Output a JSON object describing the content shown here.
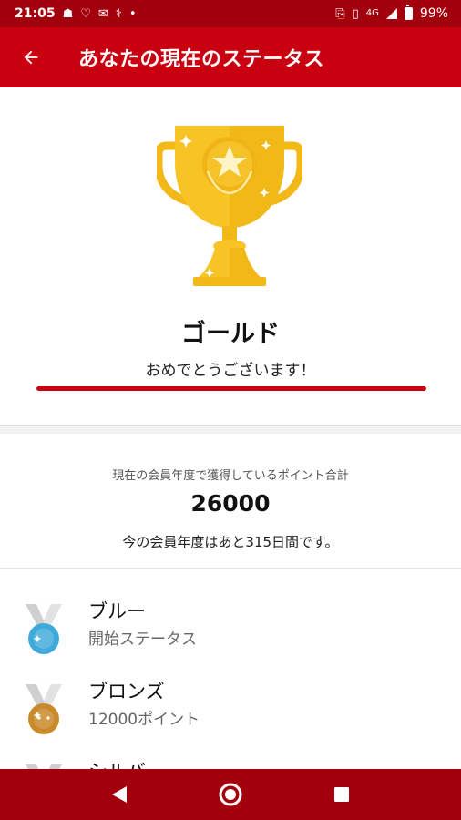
{
  "status_bar": {
    "time": "21:05",
    "network": "4G",
    "battery": "99%"
  },
  "app_bar": {
    "title": "あなたの現在のステータス",
    "back_icon": "arrow-left-icon"
  },
  "status_card": {
    "status_name": "ゴールド",
    "message": "おめでとうございます！",
    "progress_fraction": 1.0
  },
  "points": {
    "caption": "現在の会員年度で獲得しているポイント合計",
    "value": "26000",
    "remaining": "今の会員年度はあと315日間です。"
  },
  "tiers": [
    {
      "name": "ブルー",
      "description": "開始ステータス",
      "medal_color": "#3fa9d9"
    },
    {
      "name": "ブロンズ",
      "description": "12000ポイント",
      "medal_color": "#c98a2b"
    },
    {
      "name": "シルバ",
      "description": "",
      "medal_color": "#b8b8b8"
    }
  ],
  "colors": {
    "brand_red": "#c8000f",
    "dark_red": "#a3000e",
    "gold": "#f5bf1b"
  }
}
